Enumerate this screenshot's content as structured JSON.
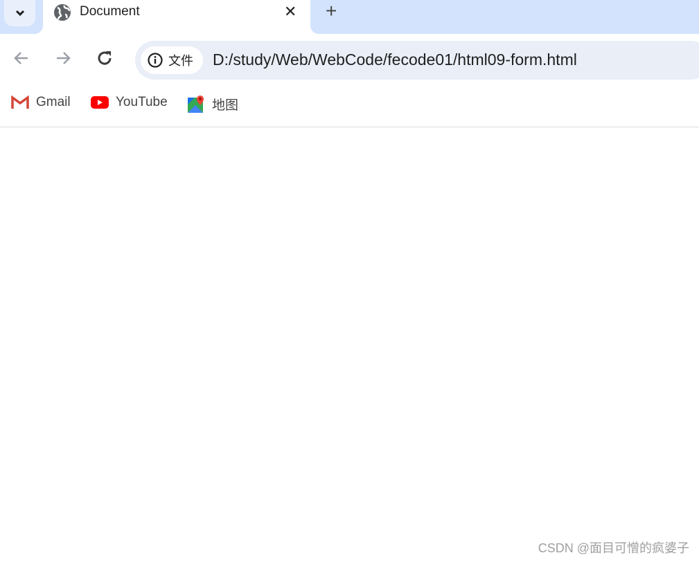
{
  "tabs": [
    {
      "title": "Document",
      "icon": "globe-icon"
    }
  ],
  "toolbar": {
    "chip_label": "文件",
    "url": "D:/study/Web/WebCode/fecode01/html09-form.html"
  },
  "bookmarks": [
    {
      "label": "Gmail",
      "icon": "gmail-icon"
    },
    {
      "label": "YouTube",
      "icon": "youtube-icon"
    },
    {
      "label": "地图",
      "icon": "maps-icon"
    }
  ],
  "watermark": "CSDN @面目可憎的疯婆子",
  "colors": {
    "tabstrip": "#d3e3fd",
    "omnibox": "#e9eef7"
  }
}
